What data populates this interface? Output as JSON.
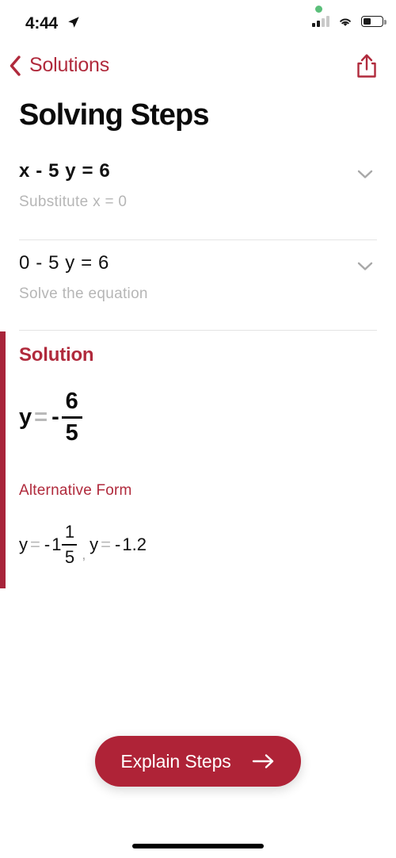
{
  "status_bar": {
    "time": "4:44",
    "location_icon": "location-arrow-icon",
    "recording_indicator": "green-recording-dot",
    "signal_icon": "cellular-signal-icon",
    "signal_bars_filled": 2,
    "signal_bars_total": 4,
    "wifi_icon": "wifi-icon",
    "battery_icon": "battery-icon",
    "battery_level_percent": 40
  },
  "nav_bar": {
    "back_label": "Solutions",
    "back_icon": "chevron-left-icon",
    "share_icon": "share-icon"
  },
  "page": {
    "title": "Solving Steps"
  },
  "steps": [
    {
      "equation": "x - 5 y = 6",
      "description": "Substitute x = 0",
      "chevron_icon": "chevron-down-icon",
      "expanded": false
    },
    {
      "equation": "0 - 5 y = 6",
      "description": "Solve the equation",
      "chevron_icon": "chevron-down-icon",
      "expanded": false
    }
  ],
  "solution": {
    "heading": "Solution",
    "variable": "y",
    "equals": "=",
    "sign": "-",
    "numerator": "6",
    "denominator": "5",
    "alt_heading": "Alternative Form",
    "alt_forms": {
      "mixed_variable": "y",
      "mixed_equals": "=",
      "mixed_sign": "-",
      "mixed_whole": "1",
      "mixed_numerator": "1",
      "mixed_denominator": "5",
      "separator": ",",
      "decimal_variable": "y",
      "decimal_equals": "=",
      "decimal_sign": "-",
      "decimal_value": "1.2"
    }
  },
  "footer": {
    "explain_label": "Explain Steps",
    "explain_arrow_icon": "arrow-right-icon"
  },
  "colors": {
    "accent": "#b02a3c",
    "accent_bar": "#a8243a",
    "button": "#af2337",
    "muted_text": "#b6b6b6",
    "divider": "#e4e4e4"
  }
}
